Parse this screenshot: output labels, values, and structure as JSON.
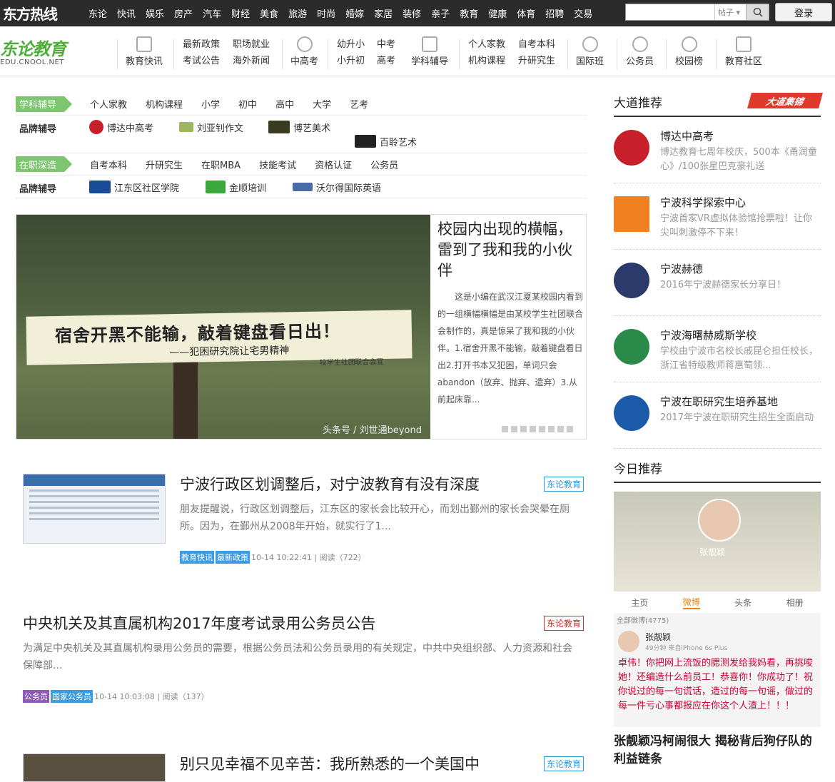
{
  "topbar": {
    "brand": "东方热线",
    "nav": [
      "东论",
      "快讯",
      "娱乐",
      "房产",
      "汽车",
      "财经",
      "美食",
      "旅游",
      "时尚",
      "婚嫁",
      "家居",
      "装修",
      "亲子",
      "教育",
      "健康",
      "体育",
      "招聘",
      "交易"
    ],
    "search_value": "",
    "search_type": "帖子",
    "login_label": "登录"
  },
  "header": {
    "logo_main": "东论教育",
    "logo_sub": "EDU.CNOOL.NET",
    "icon_items": [
      "教育快讯",
      "中高考",
      "学科辅导",
      "国际班",
      "公务员",
      "校园榜",
      "教育社区"
    ],
    "two_line_groups": [
      [
        "最新政策",
        "考试公告"
      ],
      [
        "职场就业",
        "海外新闻"
      ],
      [
        "幼升小",
        "小升初"
      ],
      [
        "中考",
        "高考"
      ],
      [
        "个人家教",
        "机构课程"
      ],
      [
        "自考本科",
        "升研究生"
      ]
    ]
  },
  "filters": {
    "row1_tag": "学科辅导",
    "row1_items": [
      "个人家教",
      "机构课程",
      "小学",
      "初中",
      "高中",
      "大学",
      "艺考"
    ],
    "brand1_label": "品牌辅导",
    "brand1_items": [
      "博达中高考",
      "刘亚钊作文",
      "博艺美术",
      "百聆艺术"
    ],
    "row2_tag": "在职深造",
    "row2_items": [
      "自考本科",
      "升研究生",
      "在职MBA",
      "技能考试",
      "资格认证",
      "公务员"
    ],
    "brand2_label": "品牌辅导",
    "brand2_items": [
      "江东区社区学院",
      "金顺培训",
      "沃尔得国际英语"
    ]
  },
  "feature": {
    "banner_line1": "宿舍开黑不能输，敲着键盘看日出！",
    "banner_line2": "——犯困研究院让宅男精神",
    "banner_line3": "校学生社团联合会宣",
    "credit": "头条号 / 刘世通beyond",
    "title": "校园内出现的横幅，雷到了我和我的小伙伴",
    "summary": "这是小编在武汉江夏某校园内看到的一组横幅横幅是由某校学生社团联合会制作的，真是惊呆了我和我的小伙伴。1.宿舍开黑不能输，敲着键盘看日出2.打开书本又犯困，单词只会abandon（放弃、抛弃、遗弃）3.从前起床靠...",
    "dot_count": 8
  },
  "articles": [
    {
      "title": "宁波行政区划调整后，对宁波教育有没有深度",
      "source": "东论教育",
      "source_color": "#2a9bd6",
      "summary": "朋友提醒说，行政区划调整后，江东区的家长会比较开心，而划出鄞州的家长会哭晕在厕所。因为，在鄞州从2008年开始，就实行了1...",
      "tags": [
        {
          "label": "教育快讯",
          "color": "#3d9be0"
        },
        {
          "label": "最新政策",
          "color": "#3d9be0"
        }
      ],
      "time": "10-14 10:22:41",
      "reads": "阅读（722）"
    },
    {
      "title": "中央机关及其直属机构2017年度考试录用公务员公告",
      "source": "东论教育",
      "source_color": "#d62a2a",
      "summary": "为满足中央机关及其直属机构录用公务员的需要，根据公务员法和公务员录用的有关规定，中共中央组织部、人力资源和社会保障部...",
      "tags": [
        {
          "label": "公务员",
          "color": "#8e5ab8"
        },
        {
          "label": "国家公务员",
          "color": "#3d9be0"
        }
      ],
      "time": "10-14 10:03:08",
      "reads": "阅读（137）"
    },
    {
      "title": "别只见幸福不见辛苦：我所熟悉的一个美国中",
      "source": "东论教育",
      "source_color": "#2a9bd6"
    }
  ],
  "right": {
    "section1_title": "大道推荐",
    "badge": "大道集锦",
    "items": [
      {
        "title": "博达中高考",
        "desc": "博达教育七周年校庆，500本《甬润童心》/100张星巴克豪礼送",
        "color": "#c8202a"
      },
      {
        "title": "宁波科学探索中心",
        "desc": "宁波首家VR虚拟体验馆抢票啦！让你尖叫刺激停不下来！",
        "color": "#f08020"
      },
      {
        "title": "宁波赫德",
        "desc": "2016年宁波赫德家长分享日！",
        "color": "#2a3a6a"
      },
      {
        "title": "宁波海曙赫威斯学校",
        "desc": "学校由宁波市名校长戚昆仑担任校长，浙江省特级教师蒋惠萄领...",
        "color": "#2a8a4a"
      },
      {
        "title": "宁波在职研究生培养基地",
        "desc": "2017年宁波在职研究生招生全面启动",
        "color": "#1a5aa8"
      }
    ],
    "section2_title": "今日推荐",
    "today": {
      "profile_name": "张靓颖",
      "tabs": [
        "主页",
        "微博",
        "头条",
        "相册"
      ],
      "active_tab": "微博",
      "sub": "全部微博(4775)",
      "author": "张靓颖",
      "author_meta": "49分钟 来自iPhone 6s Plus",
      "msg": "卓伟！你把网上流饭的腮测发给我妈看，再挑唆她！还编造什么前员工！恭喜你！你成功了！祝你说过的每一句谎话，造过的每一句谣，做过的每一件亏心事都报应在你这个人渣上！！！",
      "headline": "张靓颖冯柯闹很大 揭秘背后狗仔队的利益链条"
    }
  }
}
